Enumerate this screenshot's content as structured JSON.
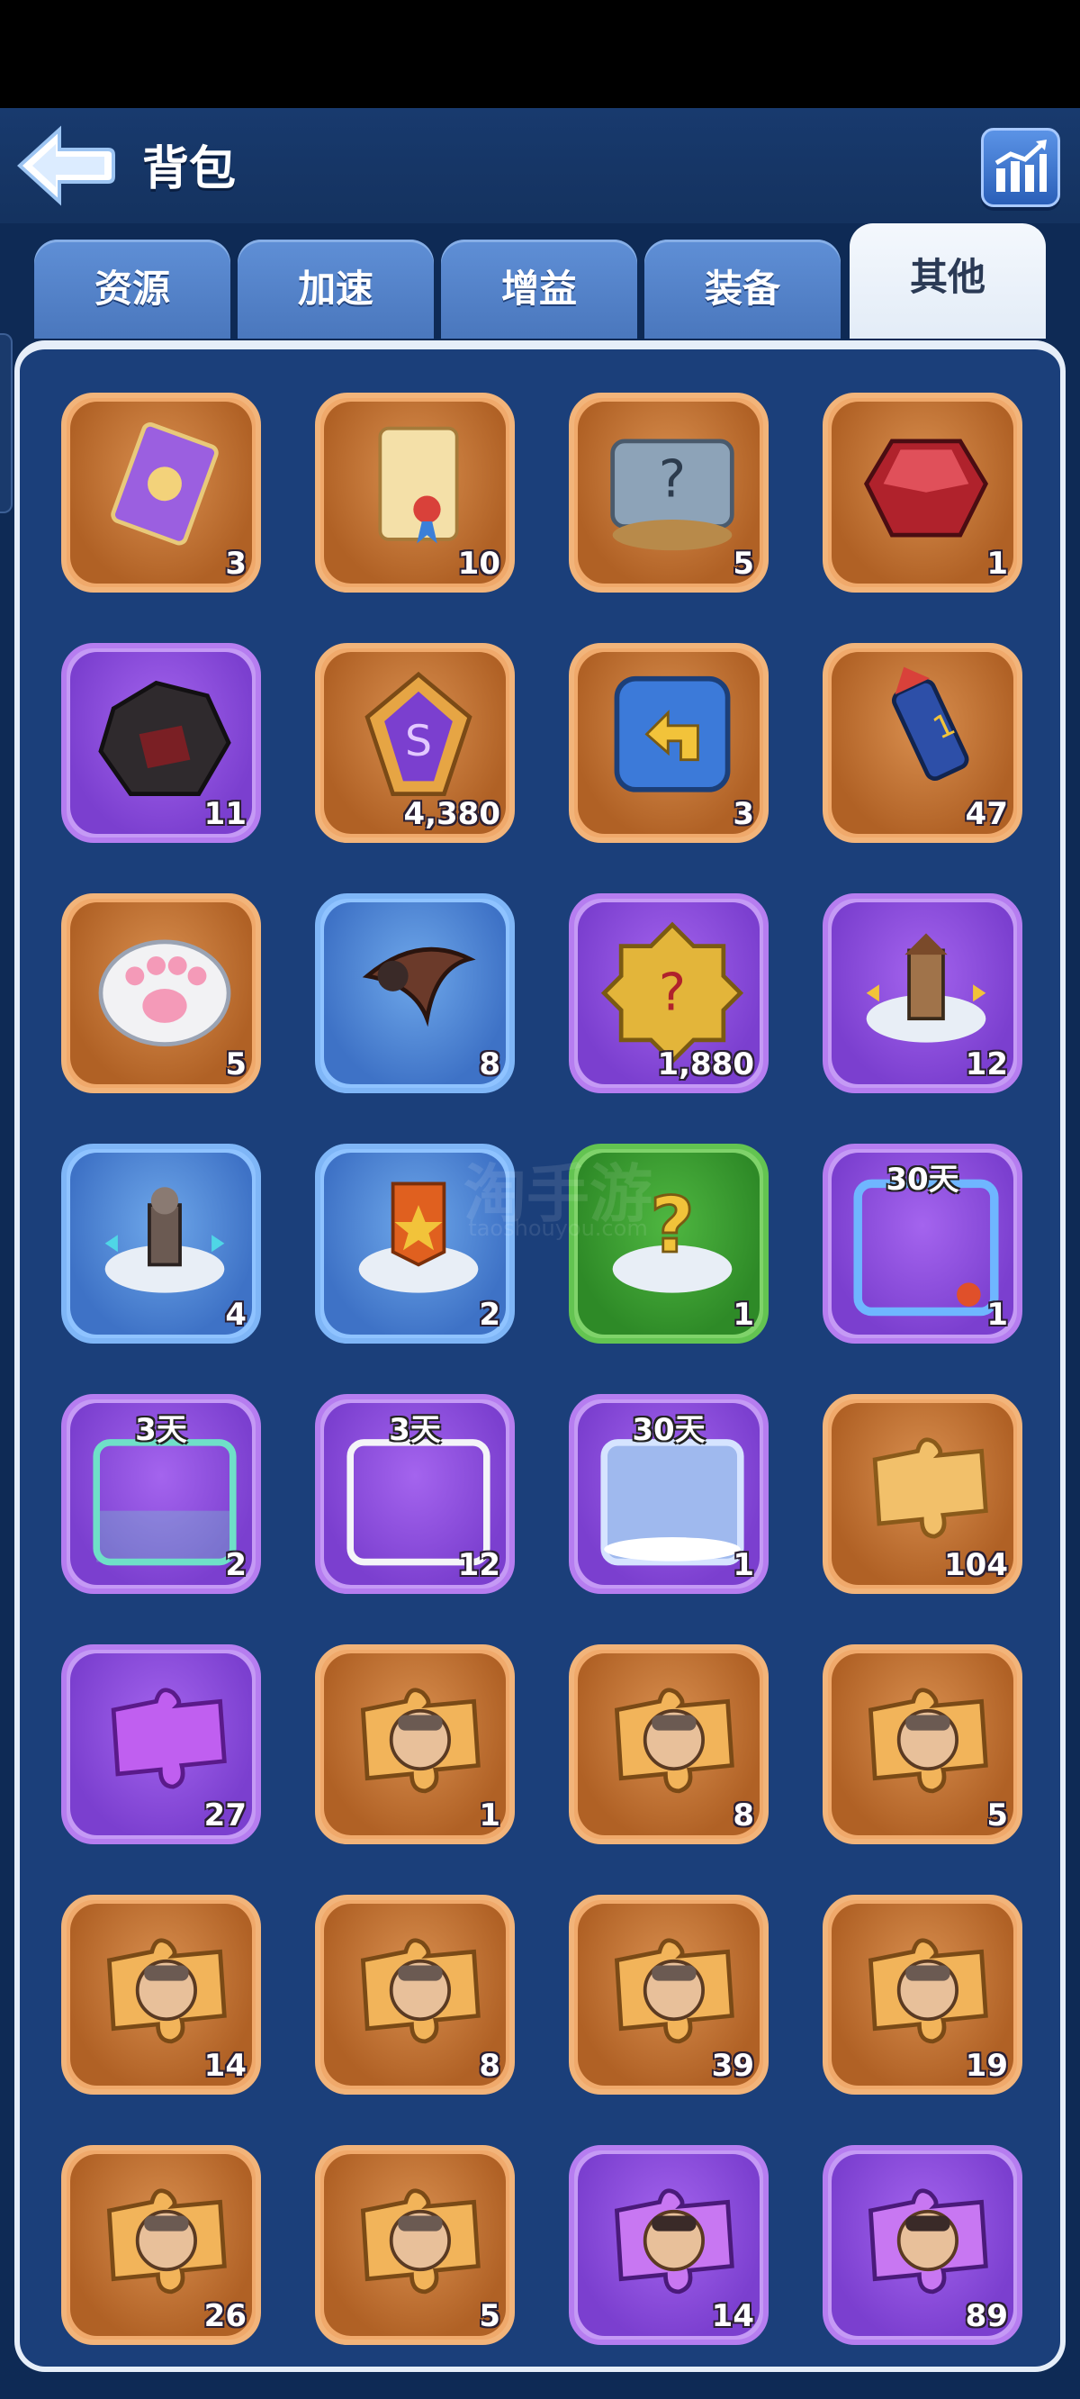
{
  "header": {
    "title": "背包"
  },
  "tabs": [
    {
      "label": "资源"
    },
    {
      "label": "加速"
    },
    {
      "label": "增益"
    },
    {
      "label": "装备"
    },
    {
      "label": "其他",
      "active": true
    }
  ],
  "items": [
    {
      "icon": "purple-card-icon",
      "rarity": "orange",
      "count": "3"
    },
    {
      "icon": "scroll-icon",
      "rarity": "orange",
      "count": "10"
    },
    {
      "icon": "mystery-chest-icon",
      "rarity": "orange",
      "count": "5"
    },
    {
      "icon": "red-gem-icon",
      "rarity": "orange",
      "count": "1"
    },
    {
      "icon": "dark-ore-icon",
      "rarity": "purple",
      "count": "11"
    },
    {
      "icon": "rune-stone-icon",
      "rarity": "orange",
      "count": "4,380"
    },
    {
      "icon": "return-arrow-icon",
      "rarity": "orange",
      "count": "3"
    },
    {
      "icon": "firework-rocket-icon",
      "rarity": "orange",
      "count": "47"
    },
    {
      "icon": "paw-cushion-icon",
      "rarity": "orange",
      "count": "5"
    },
    {
      "icon": "scythe-horn-icon",
      "rarity": "blue",
      "count": "8"
    },
    {
      "icon": "mystery-medal-icon",
      "rarity": "purple",
      "count": "1,880"
    },
    {
      "icon": "building-relocate-icon",
      "rarity": "purple",
      "count": "12"
    },
    {
      "icon": "statue-relocate-icon",
      "rarity": "blue",
      "count": "4"
    },
    {
      "icon": "banner-relocate-icon",
      "rarity": "blue",
      "count": "2"
    },
    {
      "icon": "random-relocate-icon",
      "rarity": "green",
      "count": "1"
    },
    {
      "icon": "ocean-frame-icon",
      "rarity": "purple",
      "count": "1",
      "duration": "30天"
    },
    {
      "icon": "tap-frame-icon",
      "rarity": "purple",
      "count": "2",
      "duration": "3天"
    },
    {
      "icon": "white-frame-icon",
      "rarity": "purple",
      "count": "12",
      "duration": "3天"
    },
    {
      "icon": "airship-frame-icon",
      "rarity": "purple",
      "count": "1",
      "duration": "30天"
    },
    {
      "icon": "gold-puzzle-icon",
      "rarity": "orange",
      "count": "104"
    },
    {
      "icon": "purple-puzzle-icon",
      "rarity": "purple",
      "count": "27"
    },
    {
      "icon": "hero-shard-aviator-icon",
      "rarity": "orange",
      "count": "1"
    },
    {
      "icon": "hero-shard-hooded-icon",
      "rarity": "orange",
      "count": "8"
    },
    {
      "icon": "hero-shard-yeti-icon",
      "rarity": "orange",
      "count": "5"
    },
    {
      "icon": "hero-shard-viking-icon",
      "rarity": "orange",
      "count": "14"
    },
    {
      "icon": "hero-shard-earmuff-icon",
      "rarity": "orange",
      "count": "8"
    },
    {
      "icon": "hero-shard-elder-icon",
      "rarity": "orange",
      "count": "39"
    },
    {
      "icon": "hero-shard-plague-icon",
      "rarity": "orange",
      "count": "19"
    },
    {
      "icon": "hero-shard-miner-icon",
      "rarity": "orange",
      "count": "26"
    },
    {
      "icon": "hero-shard-cap-icon",
      "rarity": "orange",
      "count": "5"
    },
    {
      "icon": "hero-shard-headlamp-icon",
      "rarity": "purple",
      "count": "14"
    },
    {
      "icon": "hero-shard-goggles-icon",
      "rarity": "purple",
      "count": "89"
    }
  ],
  "watermark": {
    "text": "淘手游",
    "sub": "taoshouyou.com"
  },
  "colors": {
    "accent": "#5f8fd6",
    "panel": "#1b3f7a",
    "orange": "#f0a96b",
    "purple": "#b67df0",
    "blue": "#7fb6f7",
    "green": "#63c451"
  }
}
